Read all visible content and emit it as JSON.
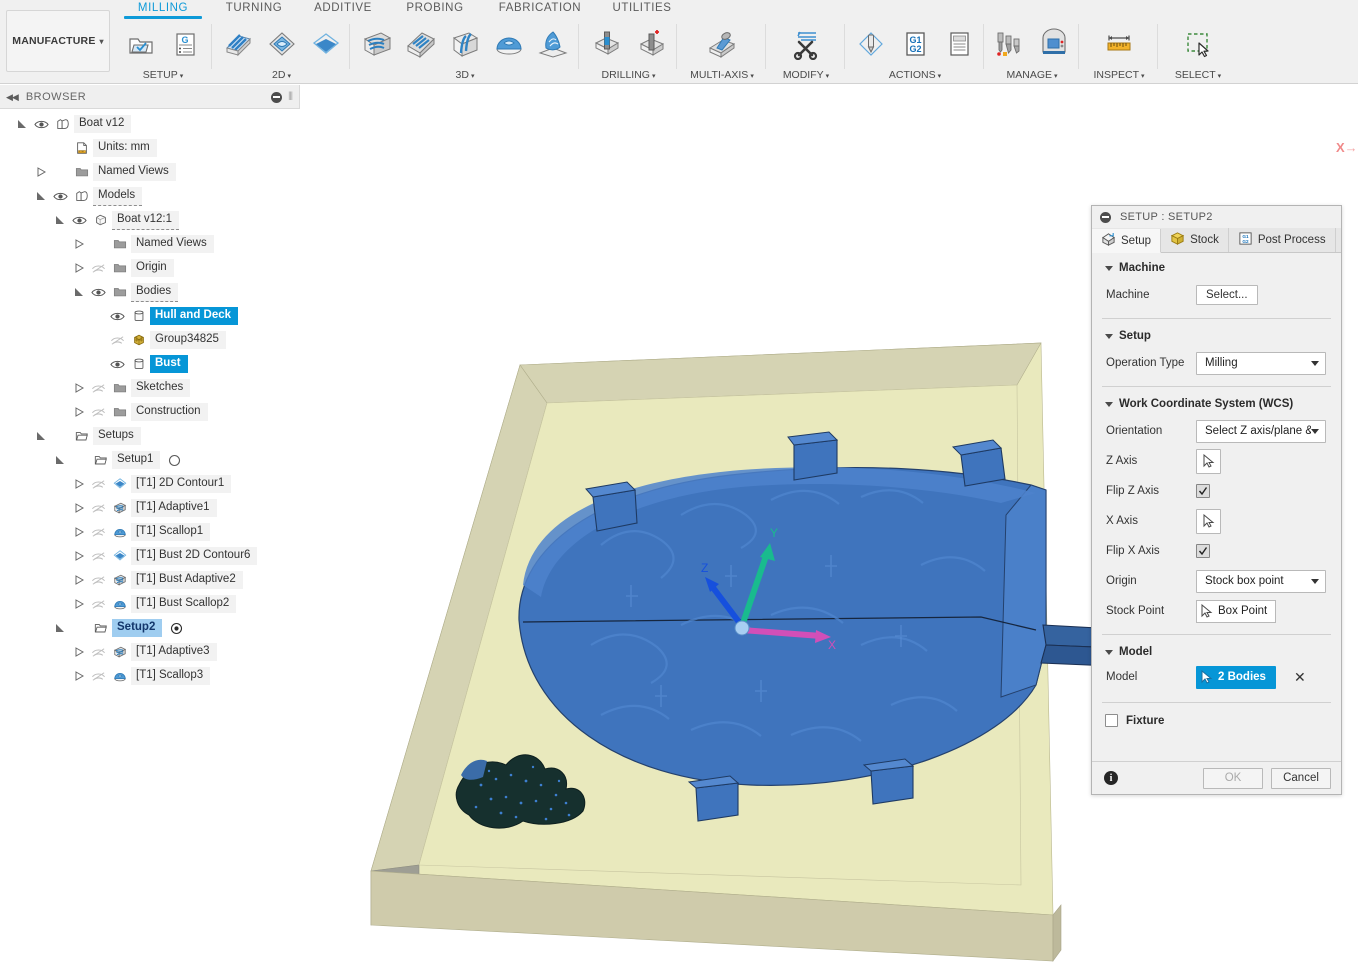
{
  "app": {
    "workspace": "MANUFACTURE",
    "workspace_caret": "▾"
  },
  "ribbon": {
    "tabs": [
      {
        "label": "MILLING",
        "active": true
      },
      {
        "label": "TURNING",
        "active": false
      },
      {
        "label": "ADDITIVE",
        "active": false
      },
      {
        "label": "PROBING",
        "active": false
      },
      {
        "label": "FABRICATION",
        "active": false
      },
      {
        "label": "UTILITIES",
        "active": false
      }
    ],
    "panels": [
      {
        "label": "SETUP",
        "caret": "▾"
      },
      {
        "label": "2D",
        "caret": "▾"
      },
      {
        "label": "3D",
        "caret": "▾"
      },
      {
        "label": "DRILLING",
        "caret": "▾"
      },
      {
        "label": "MULTI-AXIS",
        "caret": "▾"
      },
      {
        "label": "MODIFY",
        "caret": "▾"
      },
      {
        "label": "ACTIONS",
        "caret": "▾"
      },
      {
        "label": "MANAGE",
        "caret": "▾"
      },
      {
        "label": "INSPECT",
        "caret": "▾"
      },
      {
        "label": "SELECT",
        "caret": "▾"
      }
    ],
    "icons": {
      "setup": [
        "new-setup-icon",
        "new-folder-g-code-icon"
      ],
      "2d": [
        "face-icon",
        "2d-pocket-icon",
        "2d-contour-icon"
      ],
      "3d": [
        "adaptive-clearing-icon",
        "pocket-clearing-icon",
        "parallel-icon",
        "scallop-icon",
        "spiral-icon"
      ],
      "drilling": [
        "drill-icon",
        "bore-icon"
      ],
      "multiaxis": [
        "multi-axis-contour-icon"
      ],
      "modify": [
        "scissors-trim-icon"
      ],
      "actions": [
        "simulate-icon",
        "post-process-g1-g2-icon",
        "setup-sheet-icon"
      ],
      "manage": [
        "tool-library-icon",
        "machine-library-icon"
      ],
      "inspect": [
        "measure-ruler-icon"
      ],
      "select": [
        "window-select-icon"
      ]
    }
  },
  "browser": {
    "title": "BROWSER",
    "collapse_icon": "collapse-left-arrows-icon",
    "minimize_icon": "minimize-circle-icon",
    "grip_icon": "drag-grip-icon",
    "tree": [
      {
        "indent": 0,
        "arrow": "expanded",
        "eye": "visible",
        "icon": "document-component-icon",
        "label": "Boat v12",
        "state": "normal"
      },
      {
        "indent": 1,
        "arrow": "none",
        "eye": "none",
        "icon": "units-document-icon",
        "label": "Units: mm",
        "state": "normal"
      },
      {
        "indent": 1,
        "arrow": "collapsed",
        "eye": "none",
        "icon": "folder-icon",
        "label": "Named Views",
        "state": "normal"
      },
      {
        "indent": 1,
        "arrow": "expanded",
        "eye": "visible",
        "icon": "models-component-icon",
        "label": "Models",
        "state": "dashed"
      },
      {
        "indent": 2,
        "arrow": "expanded",
        "eye": "visible",
        "icon": "body-component-icon",
        "label": "Boat v12:1",
        "state": "dashed"
      },
      {
        "indent": 3,
        "arrow": "collapsed",
        "eye": "none",
        "icon": "folder-icon",
        "label": "Named Views",
        "state": "normal"
      },
      {
        "indent": 3,
        "arrow": "collapsed",
        "eye": "hidden",
        "icon": "folder-icon",
        "label": "Origin",
        "state": "normal"
      },
      {
        "indent": 3,
        "arrow": "expanded",
        "eye": "visible",
        "icon": "folder-icon",
        "label": "Bodies",
        "state": "dashed"
      },
      {
        "indent": 4,
        "arrow": "none",
        "eye": "visible",
        "icon": "solid-body-icon",
        "label": "Hull and Deck",
        "state": "selected"
      },
      {
        "indent": 4,
        "arrow": "none",
        "eye": "hidden",
        "icon": "mesh-body-icon",
        "label": "Group34825",
        "state": "normal"
      },
      {
        "indent": 4,
        "arrow": "none",
        "eye": "visible",
        "icon": "solid-body-icon",
        "label": "Bust",
        "state": "selected"
      },
      {
        "indent": 3,
        "arrow": "collapsed",
        "eye": "hidden",
        "icon": "folder-icon",
        "label": "Sketches",
        "state": "normal"
      },
      {
        "indent": 3,
        "arrow": "collapsed",
        "eye": "hidden",
        "icon": "folder-icon",
        "label": "Construction",
        "state": "normal"
      },
      {
        "indent": 1,
        "arrow": "expanded",
        "eye": "none",
        "icon": "setups-folder-icon",
        "label": "Setups",
        "state": "normal"
      },
      {
        "indent": 2,
        "arrow": "expanded",
        "eye": "none",
        "icon": "setup-folder-icon",
        "label": "Setup1",
        "state": "normal",
        "after": "circle-empty-icon"
      },
      {
        "indent": 3,
        "arrow": "collapsed",
        "eye": "hidden",
        "icon": "contour-2d-op-icon",
        "label": "[T1] 2D Contour1",
        "state": "normal"
      },
      {
        "indent": 3,
        "arrow": "collapsed",
        "eye": "hidden",
        "icon": "adaptive-op-icon",
        "label": "[T1] Adaptive1",
        "state": "normal"
      },
      {
        "indent": 3,
        "arrow": "collapsed",
        "eye": "hidden",
        "icon": "scallop-op-icon",
        "label": "[T1] Scallop1",
        "state": "normal"
      },
      {
        "indent": 3,
        "arrow": "collapsed",
        "eye": "hidden",
        "icon": "contour-2d-op-icon",
        "label": "[T1] Bust 2D Contour6",
        "state": "normal"
      },
      {
        "indent": 3,
        "arrow": "collapsed",
        "eye": "hidden",
        "icon": "adaptive-op-icon",
        "label": "[T1] Bust Adaptive2",
        "state": "normal"
      },
      {
        "indent": 3,
        "arrow": "collapsed",
        "eye": "hidden",
        "icon": "scallop-op-icon",
        "label": "[T1] Bust Scallop2",
        "state": "normal"
      },
      {
        "indent": 2,
        "arrow": "expanded",
        "eye": "none",
        "icon": "setup-folder-icon",
        "label": "Setup2",
        "state": "active",
        "after": "circle-dot-icon"
      },
      {
        "indent": 3,
        "arrow": "collapsed",
        "eye": "hidden",
        "icon": "adaptive-op-icon",
        "label": "[T1] Adaptive3",
        "state": "normal"
      },
      {
        "indent": 3,
        "arrow": "collapsed",
        "eye": "hidden",
        "icon": "scallop-op-icon",
        "label": "[T1] Scallop3",
        "state": "normal"
      }
    ]
  },
  "viewport": {
    "axis_marker": "X",
    "wcs_triad": {
      "x_label": "X",
      "y_label": "Y",
      "z_label": "Z",
      "x_color": "#d14fb8",
      "y_color": "#19bb8e",
      "z_color": "#1650dd"
    },
    "stock_top_color": "#e9e9bd",
    "stock_side_color": "#cfcbab",
    "model_color": "#3f74bd",
    "mesh_color": "#16302e"
  },
  "dialog": {
    "title": "SETUP : SETUP2",
    "collapse_icon": "minimize-circle-icon",
    "tabs": [
      {
        "label": "Setup",
        "icon": "setup-tab-icon",
        "active": true
      },
      {
        "label": "Stock",
        "icon": "stock-cube-icon",
        "active": false
      },
      {
        "label": "Post Process",
        "icon": "post-process-g1g2-icon",
        "active": false
      }
    ],
    "machine_group": {
      "title": "Machine",
      "machine_label": "Machine",
      "machine_button": "Select..."
    },
    "setup_group": {
      "title": "Setup",
      "operation_type_label": "Operation Type",
      "operation_type_value": "Milling"
    },
    "wcs_group": {
      "title": "Work Coordinate System (WCS)",
      "orientation_label": "Orientation",
      "orientation_value": "Select Z axis/plane & ...",
      "z_axis_label": "Z Axis",
      "flip_z_label": "Flip Z Axis",
      "flip_z_checked": true,
      "x_axis_label": "X Axis",
      "flip_x_label": "Flip X Axis",
      "flip_x_checked": true,
      "origin_label": "Origin",
      "origin_value": "Stock box point",
      "stock_point_label": "Stock Point",
      "stock_point_value": "Box Point"
    },
    "model_group": {
      "title": "Model",
      "model_label": "Model",
      "model_value": "2 Bodies",
      "clear_icon": "clear-selection-x-icon"
    },
    "fixture_group": {
      "title": "Fixture",
      "checked": false
    },
    "footer": {
      "info_icon": "info-icon",
      "ok_label": "OK",
      "cancel_label": "Cancel"
    }
  }
}
